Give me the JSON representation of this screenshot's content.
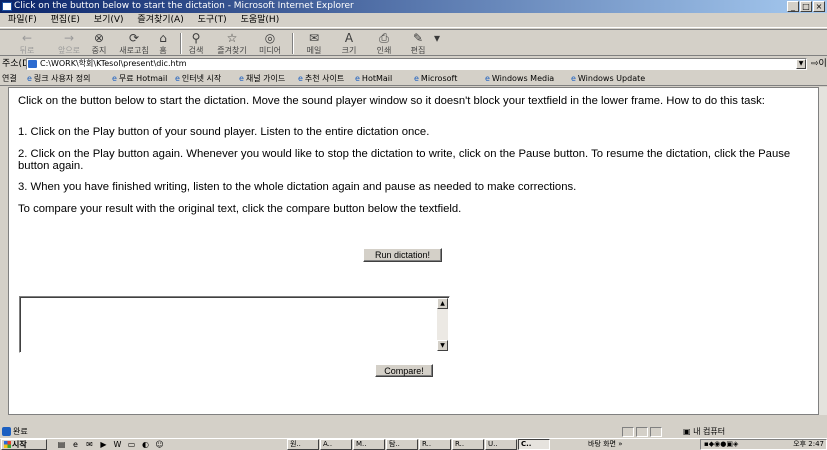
{
  "window": {
    "title": "Click on the button below to start the dictation - Microsoft Internet Explorer",
    "controls": [
      "_",
      "□",
      "×"
    ]
  },
  "menu": [
    "파일(F)",
    "편집(E)",
    "보기(V)",
    "즐겨찾기(A)",
    "도구(T)",
    "도움말(H)"
  ],
  "toolbar": {
    "back": "뒤로",
    "forward": "앞으로",
    "stop": "중지",
    "refresh": "새로고침",
    "home": "홈",
    "search": "검색",
    "favorites": "즐겨찾기",
    "media": "미디어",
    "mail": "메일",
    "size": "크기",
    "print": "인쇄",
    "edit": "편집"
  },
  "address": {
    "label": "주소(D)",
    "value": "C:\\WORK\\학회\\KTesol\\present\\dic.htm",
    "go": "이동"
  },
  "links": {
    "label": "연결",
    "items": [
      "링크 사용자 정의",
      "무료 Hotmail",
      "인터넷 시작",
      "채널 가이드",
      "추천 사이트",
      "HotMail",
      "Microsoft",
      "Windows Media",
      "Windows Update"
    ]
  },
  "page": {
    "intro": "Click on the button below to start the dictation. Move the sound player window so it doesn't block your textfield in the lower frame. How to do this task:",
    "step1": "1. Click on the Play button of your sound player. Listen to the entire dictation once.",
    "step2": "2. Click on the Play button again. Whenever you would like to stop the dictation to write, click on the Pause button. To resume the dictation, click the Pause button again.",
    "step3": "3. When you have finished writing, listen to the whole dictation again and pause as needed to make corrections.",
    "compare_note": "To compare your result with the original text, click the compare button below the textfield.",
    "run_button": "Run dictation!",
    "textarea_value": "",
    "compare_button": "Compare!"
  },
  "status": {
    "text": "완료",
    "zone": "내 컴퓨터"
  },
  "taskbar": {
    "start": "시작",
    "tasks": [
      "원..",
      "A..",
      "M..",
      "탐..",
      "R..",
      "R..",
      "U..",
      "C.."
    ],
    "active_task_index": 7,
    "deskbar": "바탕 화면 »",
    "clock": "오후 2:47"
  }
}
